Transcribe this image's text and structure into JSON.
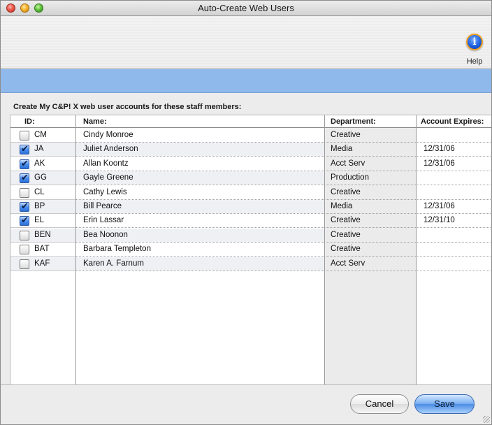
{
  "window": {
    "title": "Auto-Create Web Users"
  },
  "toolbar": {
    "help_label": "Help"
  },
  "instruction": "Create My C&P! X web user accounts for these staff members:",
  "table": {
    "headers": {
      "id": "ID:",
      "name": "Name:",
      "department": "Department:",
      "expires": "Account Expires:"
    },
    "rows": [
      {
        "checked": false,
        "id": "CM",
        "name": "Cindy Monroe",
        "department": "Creative",
        "expires": ""
      },
      {
        "checked": true,
        "id": "JA",
        "name": "Juliet Anderson",
        "department": "Media",
        "expires": "12/31/06"
      },
      {
        "checked": true,
        "id": "AK",
        "name": "Allan Koontz",
        "department": "Acct Serv",
        "expires": "12/31/06"
      },
      {
        "checked": true,
        "id": "GG",
        "name": "Gayle Greene",
        "department": "Production",
        "expires": ""
      },
      {
        "checked": false,
        "id": "CL",
        "name": "Cathy Lewis",
        "department": "Creative",
        "expires": ""
      },
      {
        "checked": true,
        "id": "BP",
        "name": "Bill Pearce",
        "department": "Media",
        "expires": "12/31/06"
      },
      {
        "checked": true,
        "id": "EL",
        "name": "Erin Lassar",
        "department": "Creative",
        "expires": "12/31/10"
      },
      {
        "checked": false,
        "id": "BEN",
        "name": "Bea Noonon",
        "department": "Creative",
        "expires": ""
      },
      {
        "checked": false,
        "id": "BAT",
        "name": "Barbara Templeton",
        "department": "Creative",
        "expires": ""
      },
      {
        "checked": false,
        "id": "KAF",
        "name": "Karen A. Farnum",
        "department": "Acct Serv",
        "expires": ""
      }
    ]
  },
  "buttons": {
    "cancel": "Cancel",
    "save": "Save"
  },
  "colors": {
    "accent_band": "#8fb8eb",
    "checkbox_checked": "#4a8ff0"
  }
}
